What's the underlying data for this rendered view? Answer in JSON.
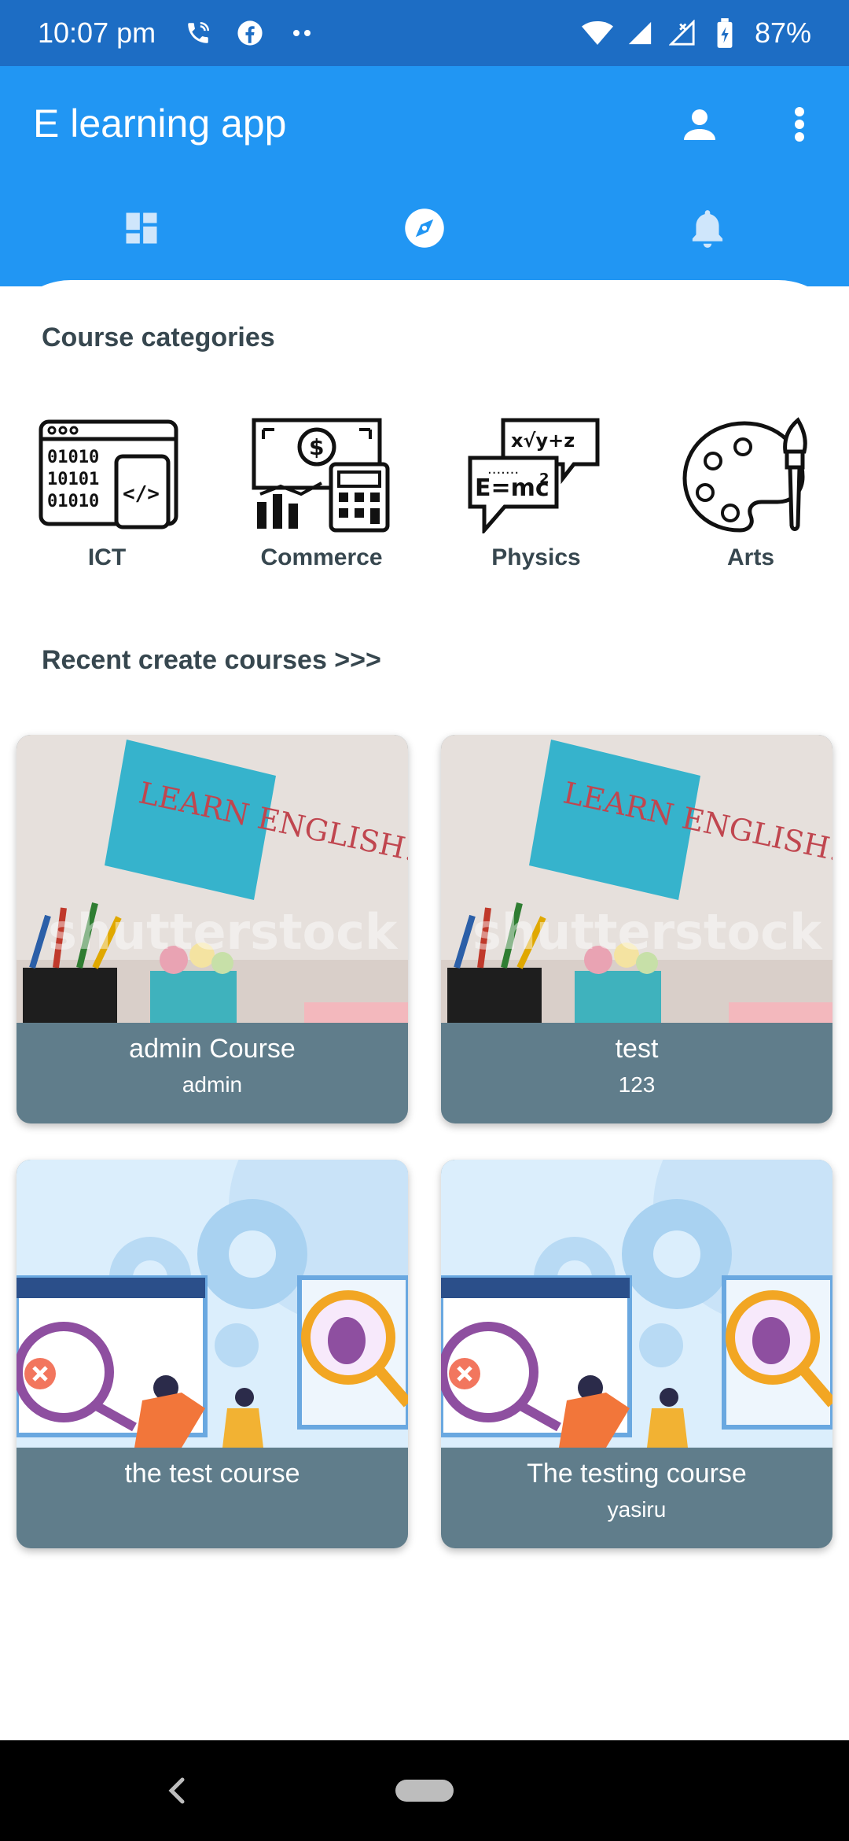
{
  "status_bar": {
    "time": "10:07 pm",
    "battery": "87%",
    "icons": [
      "wifi-calling-icon",
      "facebook-icon",
      "more-notifications-icon",
      "wifi-icon",
      "signal-icon",
      "signal-x-icon",
      "battery-charging-icon"
    ]
  },
  "app_bar": {
    "title": "E learning app",
    "actions": [
      "account-icon",
      "overflow-menu-icon"
    ],
    "tabs": [
      "dashboard-icon",
      "explore-icon",
      "notifications-icon"
    ],
    "active_tab": "explore-icon"
  },
  "categories_section": {
    "title": "Course categories",
    "items": [
      {
        "label": "ICT",
        "icon": "ict-code-icon"
      },
      {
        "label": "Commerce",
        "icon": "commerce-calculator-icon"
      },
      {
        "label": "Physics",
        "icon": "physics-formula-icon"
      },
      {
        "label": "Arts",
        "icon": "arts-palette-icon"
      }
    ]
  },
  "recent_section": {
    "title": "Recent create courses >>>",
    "courses": [
      {
        "title": "admin Course",
        "subtitle": "admin",
        "image": "learn-english-photo",
        "image_text": "LEARN ENGLISH!",
        "watermark": "shutterstock"
      },
      {
        "title": "test",
        "subtitle": "123",
        "image": "learn-english-photo",
        "image_text": "LEARN ENGLISH!",
        "watermark": "shutterstock"
      },
      {
        "title": "the test course",
        "subtitle": "",
        "image": "software-testing-illustration"
      },
      {
        "title": "The testing course",
        "subtitle": "yasiru",
        "image": "software-testing-illustration"
      }
    ]
  },
  "colors": {
    "status_bar": "#1d6dc4",
    "app_bar": "#2196f3",
    "card_caption": "#607d8b",
    "heading_text": "#37474f"
  }
}
